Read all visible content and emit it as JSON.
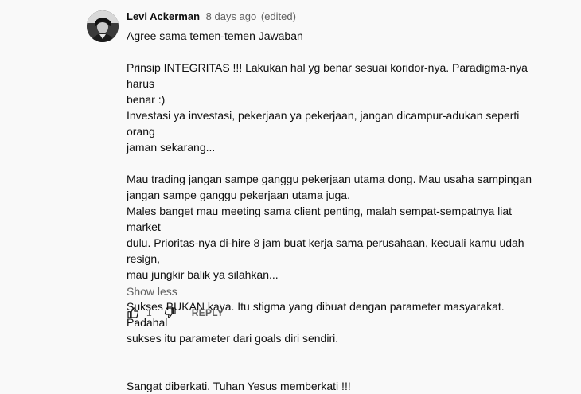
{
  "comment": {
    "author": "Levi Ackerman",
    "time": "8 days ago",
    "edited": "(edited)",
    "lines": [
      "Agree sama temen-temen Jawaban",
      "",
      "Prinsip INTEGRITAS !!! Lakukan hal yg benar sesuai koridor-nya. Paradigma-nya harus",
      "benar :)",
      "Investasi ya investasi, pekerjaan ya pekerjaan, jangan dicampur-adukan seperti orang",
      "jaman sekarang...",
      "",
      "Mau trading jangan sampe ganggu pekerjaan utama dong. Mau usaha sampingan",
      "jangan sampe ganggu pekerjaan utama juga.",
      "Males banget mau meeting sama client penting, malah sempat-sempatnya liat market",
      "dulu. Prioritas-nya di-hire 8 jam buat kerja sama perusahaan, kecuali kamu udah resign,",
      "mau jungkir balik ya silahkan...",
      "",
      "Sukses BUKAN kaya. Itu stigma yang dibuat dengan parameter masyarakat. Padahal",
      "sukses itu parameter dari goals diri sendiri.",
      "",
      "",
      "Sangat diberkati. Tuhan Yesus memberkati !!!"
    ],
    "show_less": "Show less",
    "like_count": "1",
    "reply_label": "REPLY",
    "icons": {
      "like": "thumbs-up-icon",
      "dislike": "thumbs-down-icon"
    }
  }
}
